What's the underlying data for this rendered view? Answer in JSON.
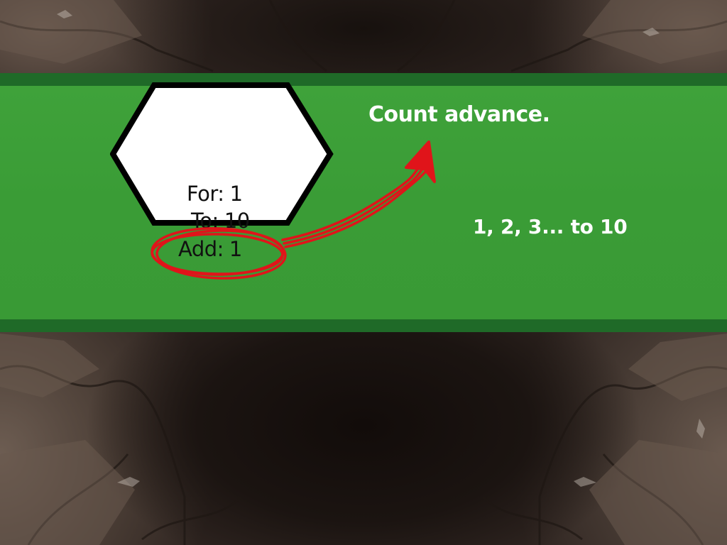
{
  "tutorial": {
    "title": "Count advance.",
    "result": "1, 2, 3... to 10"
  },
  "loop_block": {
    "for_label": "For:",
    "for_value": "1",
    "to_label": "To:",
    "to_value": "10",
    "add_label": "Add:",
    "add_value": "1"
  },
  "icons": {
    "hexagon": "hexagon-block-icon",
    "circle": "highlight-circle-icon",
    "arrow": "arrow-icon"
  },
  "colors": {
    "banner": "#3a9c36",
    "banner_border": "#1f6a28",
    "highlight": "#e0141a",
    "text": "#ffffff"
  }
}
